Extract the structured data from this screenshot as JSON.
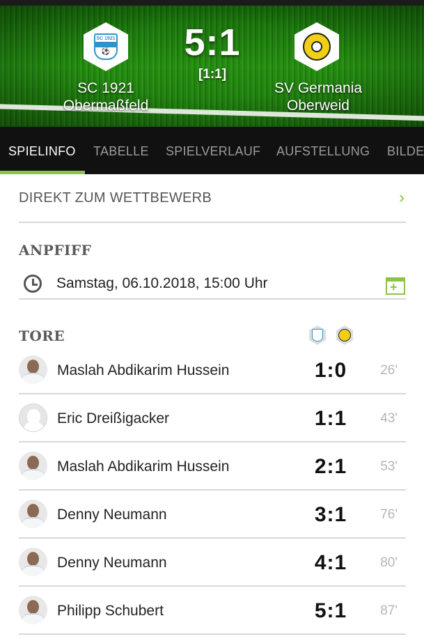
{
  "match": {
    "home_team": "SC 1921\nObermaßfeld",
    "home_line1": "SC 1921",
    "home_line2": "Obermaßfeld",
    "away_line1": "SV Germania",
    "away_line2": "Oberweid",
    "score": "5:1",
    "halftime": "[1:1]",
    "home_crest_text": "SC 1921"
  },
  "tabs": [
    {
      "label": "SPIELINFO",
      "active": true
    },
    {
      "label": "TABELLE",
      "active": false
    },
    {
      "label": "SPIELVERLAUF",
      "active": false
    },
    {
      "label": "AUFSTELLUNG",
      "active": false
    },
    {
      "label": "BILDE",
      "active": false
    }
  ],
  "competition_link": {
    "label": "DIREKT ZUM WETTBEWERB",
    "chevron": "›"
  },
  "kickoff": {
    "heading": "ANPFIFF",
    "datetime": "Samstag, 06.10.2018, 15:00 Uhr",
    "icon": "clock-icon",
    "action_icon": "calendar-add-icon"
  },
  "goals": {
    "heading": "TORE",
    "items": [
      {
        "player": "Maslah Abdikarim Hussein",
        "score": "1:0",
        "minute": "26'",
        "avatar": "photo"
      },
      {
        "player": "Eric Dreißigacker",
        "score": "1:1",
        "minute": "43'",
        "avatar": "placeholder"
      },
      {
        "player": "Maslah Abdikarim Hussein",
        "score": "2:1",
        "minute": "53'",
        "avatar": "photo"
      },
      {
        "player": "Denny Neumann",
        "score": "3:1",
        "minute": "76'",
        "avatar": "photo"
      },
      {
        "player": "Denny Neumann",
        "score": "4:1",
        "minute": "80'",
        "avatar": "photo"
      },
      {
        "player": "Philipp Schubert",
        "score": "5:1",
        "minute": "87'",
        "avatar": "photo"
      }
    ]
  },
  "colors": {
    "accent": "#8bc34a",
    "tabbar": "#111111",
    "home_blue": "#2f93c8",
    "away_yellow": "#f1cf15"
  }
}
